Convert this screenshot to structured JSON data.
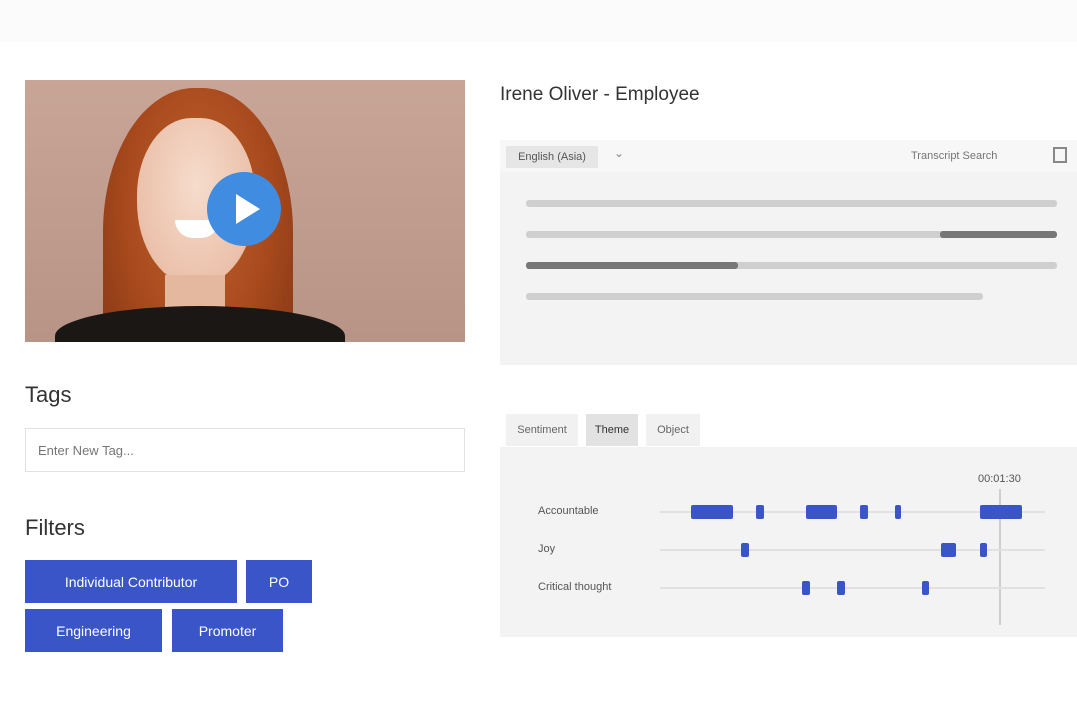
{
  "video": {
    "play_icon": "play-icon"
  },
  "person": {
    "title": "Irene Oliver - Employee"
  },
  "transcript": {
    "language": "English (Asia)",
    "search_placeholder": "Transcript Search",
    "doc_icon": "document-icon",
    "lines": [
      {
        "start": 0.0,
        "end": 1.0,
        "highlight_from": null
      },
      {
        "start": 0.0,
        "end": 1.0,
        "highlight_from": 0.78
      },
      {
        "start": 0.0,
        "end": 1.0,
        "highlight_to": 0.4
      },
      {
        "start": 0.0,
        "end": 0.86,
        "highlight_from": null
      }
    ]
  },
  "tags": {
    "title": "Tags",
    "input_placeholder": "Enter New Tag..."
  },
  "filters": {
    "title": "Filters",
    "chips": [
      "Individual Contributor",
      "PO",
      "Engineering",
      "Promoter"
    ]
  },
  "analysis": {
    "tabs": [
      {
        "label": "Sentiment",
        "active": false
      },
      {
        "label": "Theme",
        "active": true
      },
      {
        "label": "Object",
        "active": false
      }
    ],
    "time_label": "00:01:30",
    "playhead_fraction": 0.88,
    "rows": [
      {
        "label": "Accountable",
        "marks": [
          [
            0.08,
            0.19
          ],
          [
            0.25,
            0.27
          ],
          [
            0.38,
            0.46
          ],
          [
            0.52,
            0.54
          ],
          [
            0.61,
            0.62
          ],
          [
            0.83,
            0.94
          ]
        ]
      },
      {
        "label": "Joy",
        "marks": [
          [
            0.21,
            0.23
          ],
          [
            0.73,
            0.77
          ],
          [
            0.83,
            0.85
          ]
        ]
      },
      {
        "label": "Critical thought",
        "marks": [
          [
            0.37,
            0.39
          ],
          [
            0.46,
            0.48
          ],
          [
            0.68,
            0.7
          ]
        ]
      }
    ]
  },
  "colors": {
    "accent": "#3a55c7",
    "play": "#3f8ce0",
    "panel": "#f3f3f3"
  }
}
